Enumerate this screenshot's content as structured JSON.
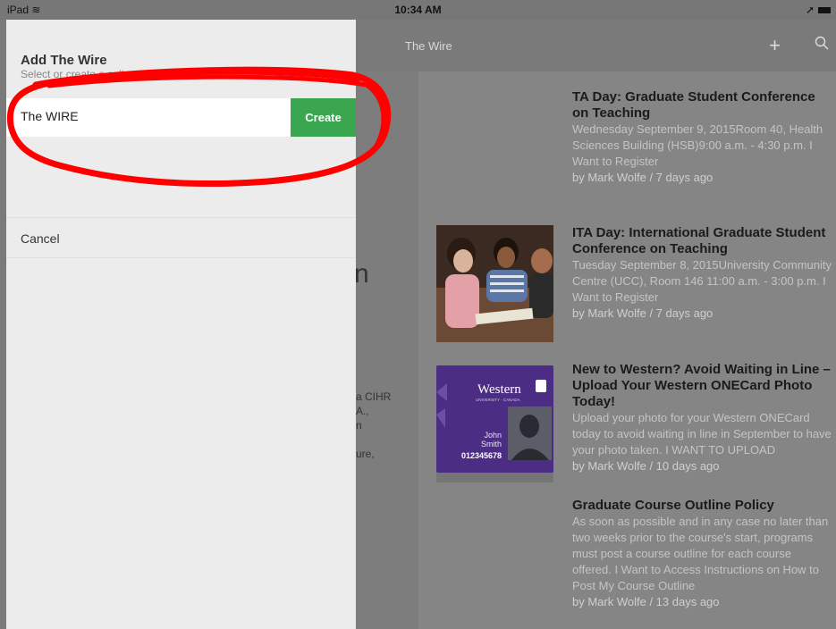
{
  "status": {
    "device": "iPad",
    "time": "10:34 AM"
  },
  "nav": {
    "title": "The Wire",
    "add_icon": "plus-icon",
    "search_icon": "search-icon"
  },
  "background_fragments": [
    "n",
    "a CIHR",
    "A.,",
    "n",
    "ure,"
  ],
  "articles": [
    {
      "title": "TA Day: Graduate Student Conference on Teaching",
      "body": "Wednesday September 9, 2015Room 40, Health Sciences Building (HSB)9:00 a.m. - 4:30 p.m. I Want to Register",
      "meta": "by Mark Wolfe / 7 days ago"
    },
    {
      "title": "ITA Day: International Graduate Student Conference on Teaching",
      "body": "Tuesday September 8, 2015University Community Centre (UCC), Room 146 11:00 a.m. - 3:00 p.m. I Want to Register",
      "meta": "by Mark Wolfe / 7 days ago"
    },
    {
      "title": "New to Western? Avoid Waiting in Line – Upload Your Western ONECard Photo Today!",
      "body": "Upload your photo for your Western ONECard today to avoid waiting in line in September to have your photo taken. I WANT TO UPLOAD",
      "meta": "by Mark Wolfe / 10 days ago"
    },
    {
      "title": "Graduate Course Outline Policy",
      "body": "As soon as possible and in any case no later than two weeks prior to the course's start, programs must post a course outline for each course offered. I Want to Access Instructions on How to Post My Course Outline",
      "meta": "by Mark Wolfe / 13 days ago"
    }
  ],
  "card": {
    "brand": "Western",
    "subtitle": "UNIVERSITY · CANADA",
    "first": "John",
    "last": "Smith",
    "number": "012345678"
  },
  "panel": {
    "title": "Add The Wire",
    "subtitle": "Select or create a collection",
    "input_value": "The WIRE",
    "create_label": "Create",
    "cancel_label": "Cancel"
  },
  "colors": {
    "accent_green": "#3aa64f",
    "annotation_red": "#ff0000",
    "card_purple": "#4b2e83"
  }
}
